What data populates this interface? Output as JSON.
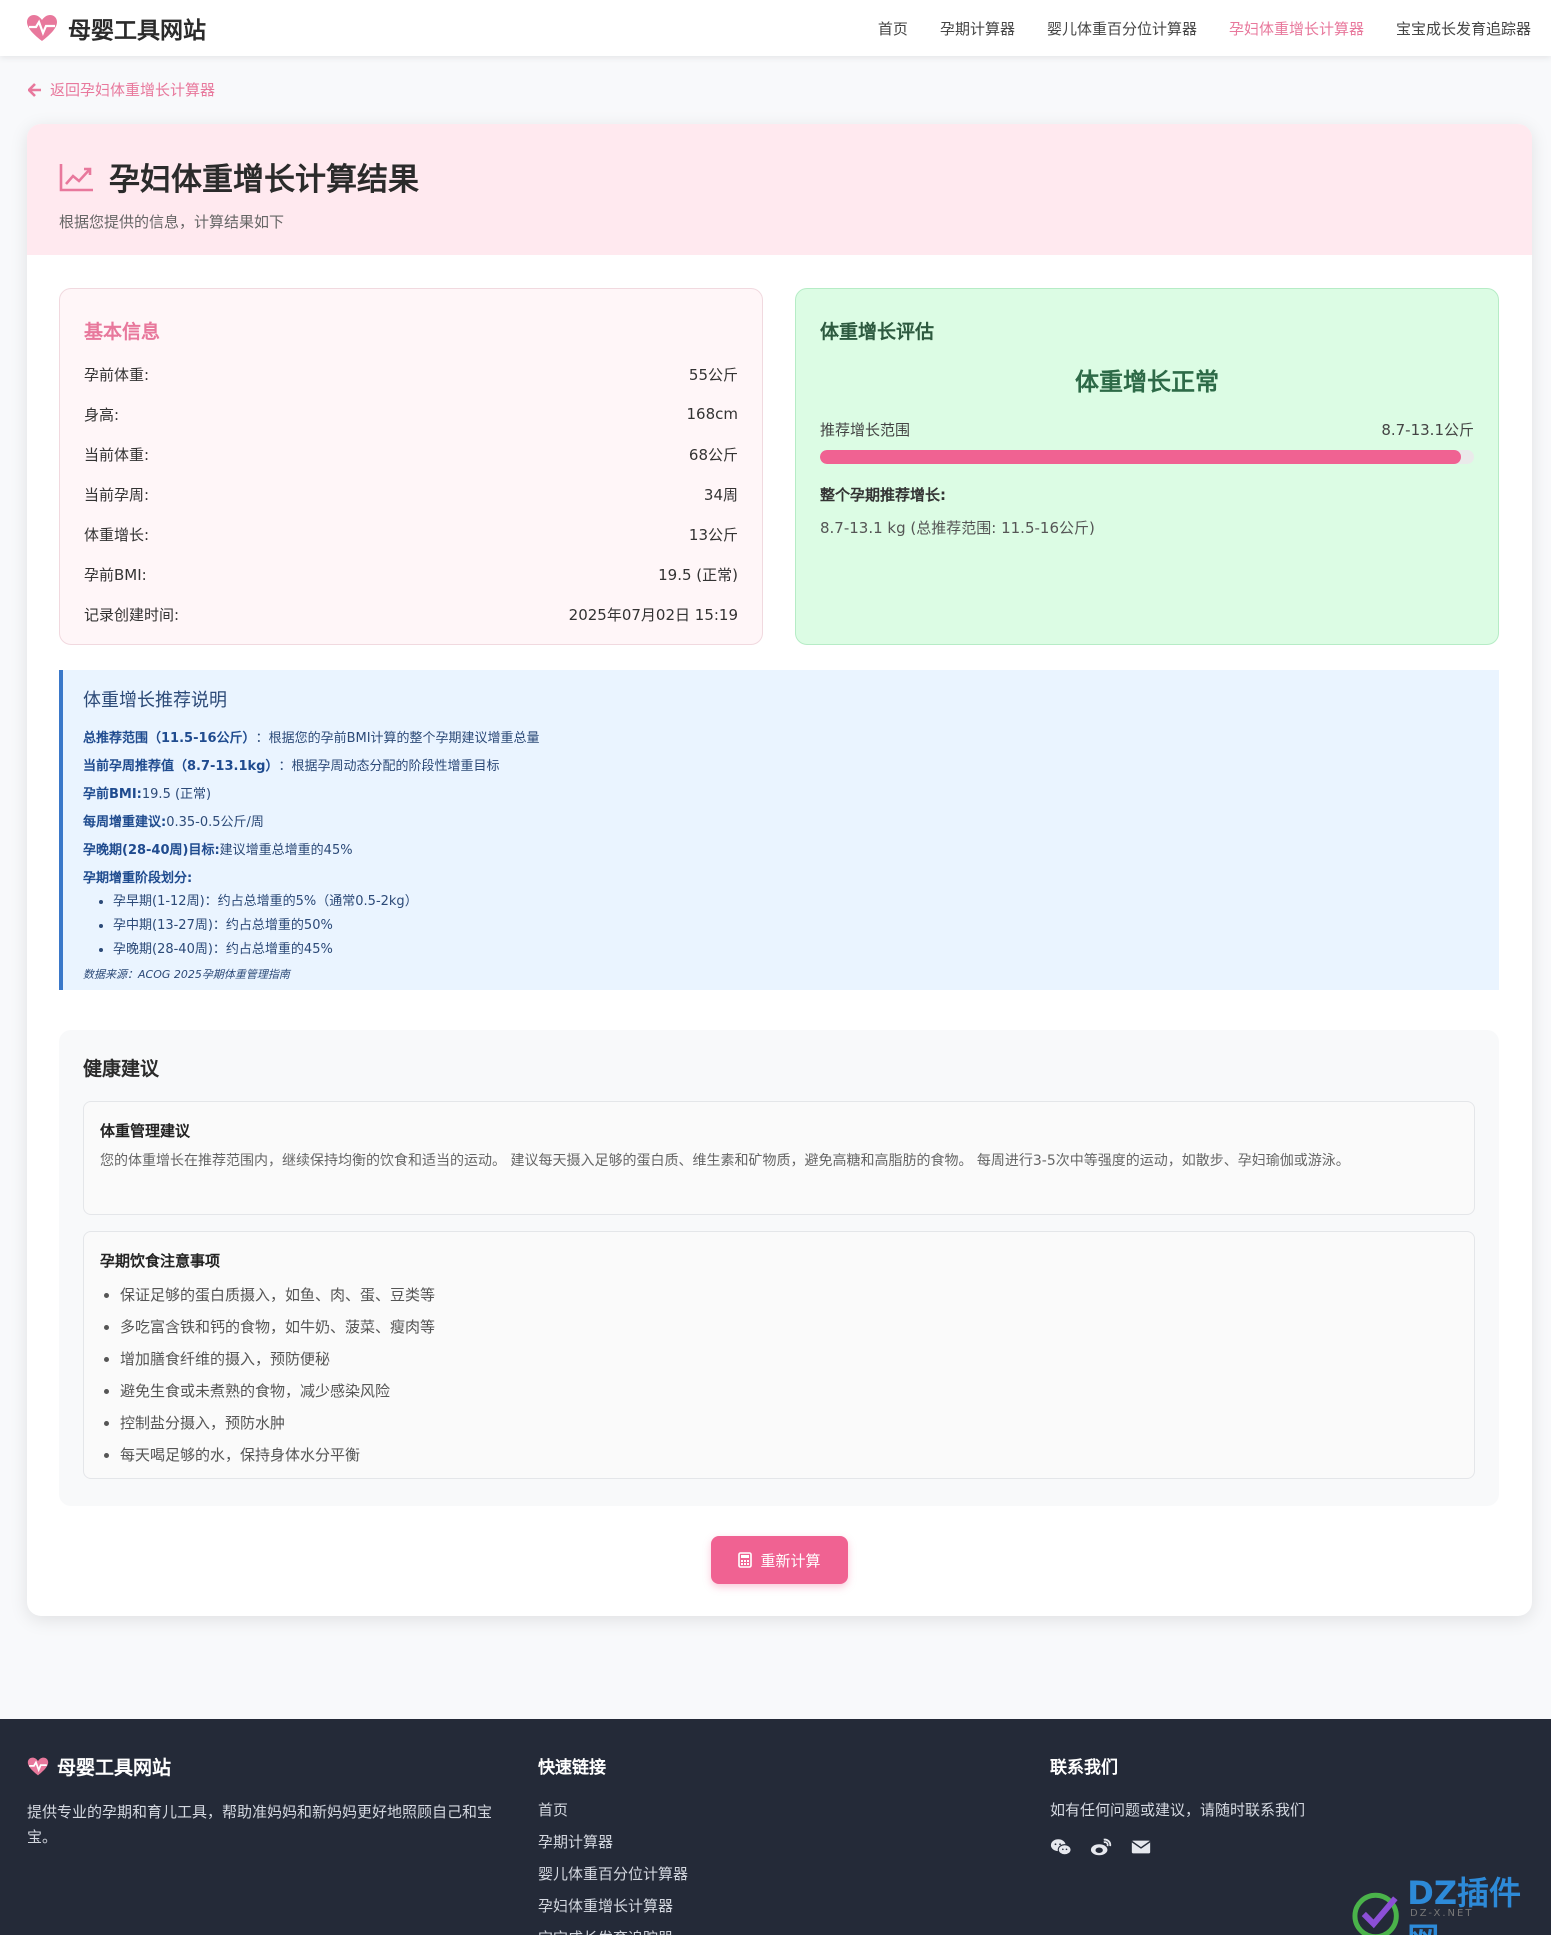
{
  "brand": {
    "name": "母婴工具网站"
  },
  "nav": {
    "items": [
      {
        "label": "首页",
        "active": false
      },
      {
        "label": "孕期计算器",
        "active": false
      },
      {
        "label": "婴儿体重百分位计算器",
        "active": false
      },
      {
        "label": "孕妇体重增长计算器",
        "active": true
      },
      {
        "label": "宝宝成长发育追踪器",
        "active": false
      }
    ]
  },
  "back_link": "返回孕妇体重增长计算器",
  "header": {
    "title": "孕妇体重增长计算结果",
    "subtitle": "根据您提供的信息，计算结果如下"
  },
  "basic_info": {
    "title": "基本信息",
    "rows": [
      {
        "label": "孕前体重:",
        "value": "55公斤"
      },
      {
        "label": "身高:",
        "value": "168cm"
      },
      {
        "label": "当前体重:",
        "value": "68公斤"
      },
      {
        "label": "当前孕周:",
        "value": "34周"
      },
      {
        "label": "体重增长:",
        "value": "13公斤"
      },
      {
        "label": "孕前BMI:",
        "value": "19.5 (正常)"
      },
      {
        "label": "记录创建时间:",
        "value": "2025年07月02日 15:19"
      }
    ]
  },
  "evaluation": {
    "title": "体重增长评估",
    "status": "体重增长正常",
    "range_label": "推荐增长范围",
    "range_value": "8.7-13.1公斤",
    "progress_fraction": 0.98,
    "total_label": "整个孕期推荐增长:",
    "total_value": "8.7-13.1 kg (总推荐范围: 11.5-16公斤)"
  },
  "explanation": {
    "title": "体重增长推荐说明",
    "lines": [
      {
        "key": "总推荐范围（11.5-16公斤）",
        "text": "：根据您的孕前BMI计算的整个孕期建议增重总量"
      },
      {
        "key": "当前孕周推荐值（8.7-13.1kg）",
        "text": "：根据孕周动态分配的阶段性增重目标"
      },
      {
        "key": "孕前BMI:",
        "text": "19.5 (正常)"
      },
      {
        "key": "每周增重建议:",
        "text": "0.35-0.5公斤/周"
      },
      {
        "key": "孕晚期(28-40周)目标:",
        "text": "建议增重总增重的45%"
      }
    ],
    "stages_title": "孕期增重阶段划分:",
    "stages": [
      "孕早期(1-12周)：约占总增重的5%（通常0.5-2kg）",
      "孕中期(13-27周)：约占总增重的50%",
      "孕晚期(28-40周)：约占总增重的45%"
    ],
    "source": "数据来源：ACOG 2025孕期体重管理指南"
  },
  "health": {
    "title": "健康建议",
    "management": {
      "title": "体重管理建议",
      "text": "您的体重增长在推荐范围内，继续保持均衡的饮食和适当的运动。 建议每天摄入足够的蛋白质、维生素和矿物质，避免高糖和高脂肪的食物。 每周进行3-5次中等强度的运动，如散步、孕妇瑜伽或游泳。"
    },
    "diet": {
      "title": "孕期饮食注意事项",
      "items": [
        "保证足够的蛋白质摄入，如鱼、肉、蛋、豆类等",
        "多吃富含铁和钙的食物，如牛奶、菠菜、瘦肉等",
        "增加膳食纤维的摄入，预防便秘",
        "避免生食或未煮熟的食物，减少感染风险",
        "控制盐分摄入，预防水肿",
        "每天喝足够的水，保持身体水分平衡"
      ]
    }
  },
  "recalc_button": "重新计算",
  "footer": {
    "brand": "母婴工具网站",
    "description": "提供专业的孕期和育儿工具，帮助准妈妈和新妈妈更好地照顾自己和宝宝。",
    "quick_links_title": "快速链接",
    "quick_links": [
      "首页",
      "孕期计算器",
      "婴儿体重百分位计算器",
      "孕妇体重增长计算器",
      "宝宝成长发育追踪器"
    ],
    "contact_title": "联系我们",
    "contact_text": "如有任何问题或建议，请随时联系我们",
    "contact_icons": [
      "wechat-icon",
      "weibo-icon",
      "email-icon"
    ]
  },
  "watermark": {
    "text": "DZ插件网",
    "sub": "DZ-X.NET"
  },
  "colors": {
    "accent": "#f06292",
    "pink_text": "#e8789c",
    "footer_bg": "#242a38"
  }
}
